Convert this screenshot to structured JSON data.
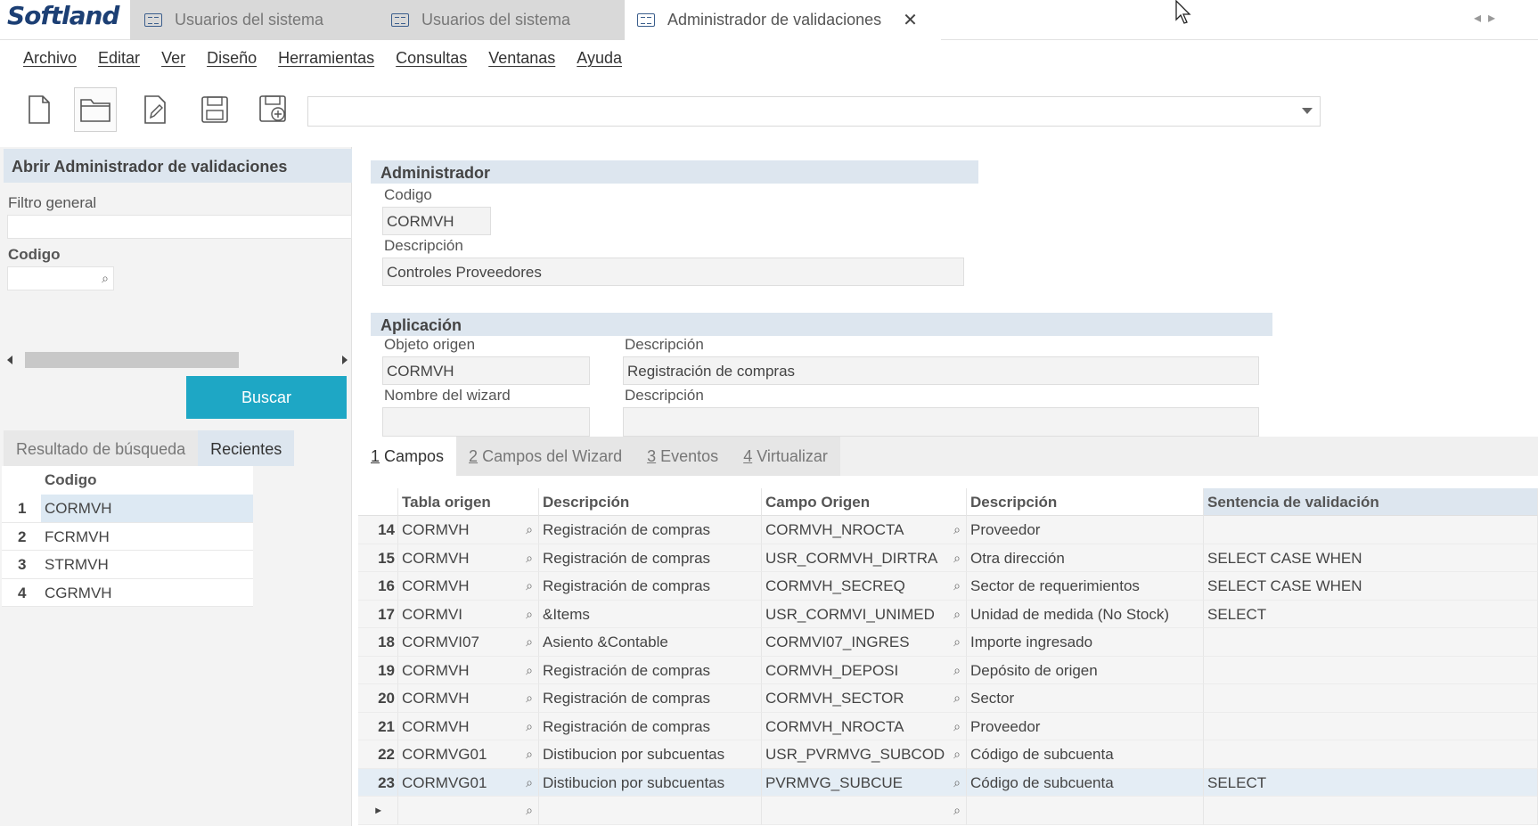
{
  "app": {
    "logo": "Softland"
  },
  "tabs": [
    {
      "label": "Usuarios del sistema"
    },
    {
      "label": "Usuarios del sistema"
    },
    {
      "label": "Administrador de validaciones",
      "close": "✕"
    }
  ],
  "menu": [
    "Archivo",
    "Editar",
    "Ver",
    "Diseño",
    "Herramientas",
    "Consultas",
    "Ventanas",
    "Ayuda"
  ],
  "toolbar": {
    "icons": [
      "new-document-icon",
      "open-folder-icon",
      "edit-icon",
      "save-icon",
      "save-as-icon"
    ],
    "combo_value": ""
  },
  "left": {
    "title": "Abrir Administrador de validaciones",
    "filtro_label": "Filtro general",
    "filtro_value": "",
    "codigo_label": "Codigo",
    "codigo_value": "",
    "buscar": "Buscar",
    "tab_resultado": "Resultado de búsqueda",
    "tab_recientes": "Recientes",
    "recent_header": "Codigo",
    "recent": [
      {
        "n": "1",
        "code": "CORMVH"
      },
      {
        "n": "2",
        "code": "FCRMVH"
      },
      {
        "n": "3",
        "code": "STRMVH"
      },
      {
        "n": "4",
        "code": "CGRMVH"
      }
    ]
  },
  "admin": {
    "header": "Administrador",
    "codigo_label": "Codigo",
    "codigo_value": "CORMVH",
    "desc_label": "Descripción",
    "desc_value": "Controles Proveedores"
  },
  "aplicacion": {
    "header": "Aplicación",
    "objeto_label": "Objeto origen",
    "objeto_value": "CORMVH",
    "desc1_label": "Descripción",
    "desc1_value": "Registración de compras",
    "wizard_label": "Nombre del wizard",
    "wizard_value": "",
    "desc2_label": "Descripción",
    "desc2_value": ""
  },
  "lower_tabs": [
    {
      "key": "1",
      "label": " Campos"
    },
    {
      "key": "2",
      "label": " Campos del Wizard"
    },
    {
      "key": "3",
      "label": " Eventos"
    },
    {
      "key": "4",
      "label": " Virtualizar"
    }
  ],
  "grid": {
    "headers": [
      "Tabla origen",
      "Descripción",
      "Campo Origen",
      "Descripción",
      "Sentencia de validación"
    ],
    "rows": [
      {
        "n": "14",
        "tabla": "CORMVH",
        "desc": "Registración de compras",
        "campo": "CORMVH_NROCTA",
        "desc2": "Proveedor",
        "sent": ""
      },
      {
        "n": "15",
        "tabla": "CORMVH",
        "desc": "Registración de compras",
        "campo": "USR_CORMVH_DIRTRA",
        "desc2": "Otra dirección",
        "sent": "SELECT CASE WHEN"
      },
      {
        "n": "16",
        "tabla": "CORMVH",
        "desc": "Registración de compras",
        "campo": "CORMVH_SECREQ",
        "desc2": "Sector de requerimientos",
        "sent": "SELECT CASE WHEN"
      },
      {
        "n": "17",
        "tabla": "CORMVI",
        "desc": "&Items",
        "campo": "USR_CORMVI_UNIMED",
        "desc2": "Unidad de medida (No Stock)",
        "sent": "SELECT"
      },
      {
        "n": "18",
        "tabla": "CORMVI07",
        "desc": "Asiento &Contable",
        "campo": "CORMVI07_INGRES",
        "desc2": "Importe ingresado",
        "sent": ""
      },
      {
        "n": "19",
        "tabla": "CORMVH",
        "desc": "Registración de compras",
        "campo": "CORMVH_DEPOSI",
        "desc2": "Depósito de origen",
        "sent": ""
      },
      {
        "n": "20",
        "tabla": "CORMVH",
        "desc": "Registración de compras",
        "campo": "CORMVH_SECTOR",
        "desc2": "Sector",
        "sent": ""
      },
      {
        "n": "21",
        "tabla": "CORMVH",
        "desc": "Registración de compras",
        "campo": "CORMVH_NROCTA",
        "desc2": "Proveedor",
        "sent": ""
      },
      {
        "n": "22",
        "tabla": "CORMVG01",
        "desc": "Distibucion por subcuentas",
        "campo": "USR_PVRMVG_SUBCOD",
        "desc2": "Código de subcuenta",
        "sent": ""
      },
      {
        "n": "23",
        "tabla": "CORMVG01",
        "desc": "Distibucion por subcuentas",
        "campo": "PVRMVG_SUBCUE",
        "desc2": "Código de subcuenta",
        "sent": "SELECT"
      }
    ]
  },
  "colors": {
    "accent": "#1ea7c5",
    "section": "#dde6ef",
    "brand": "#1c3f74"
  }
}
